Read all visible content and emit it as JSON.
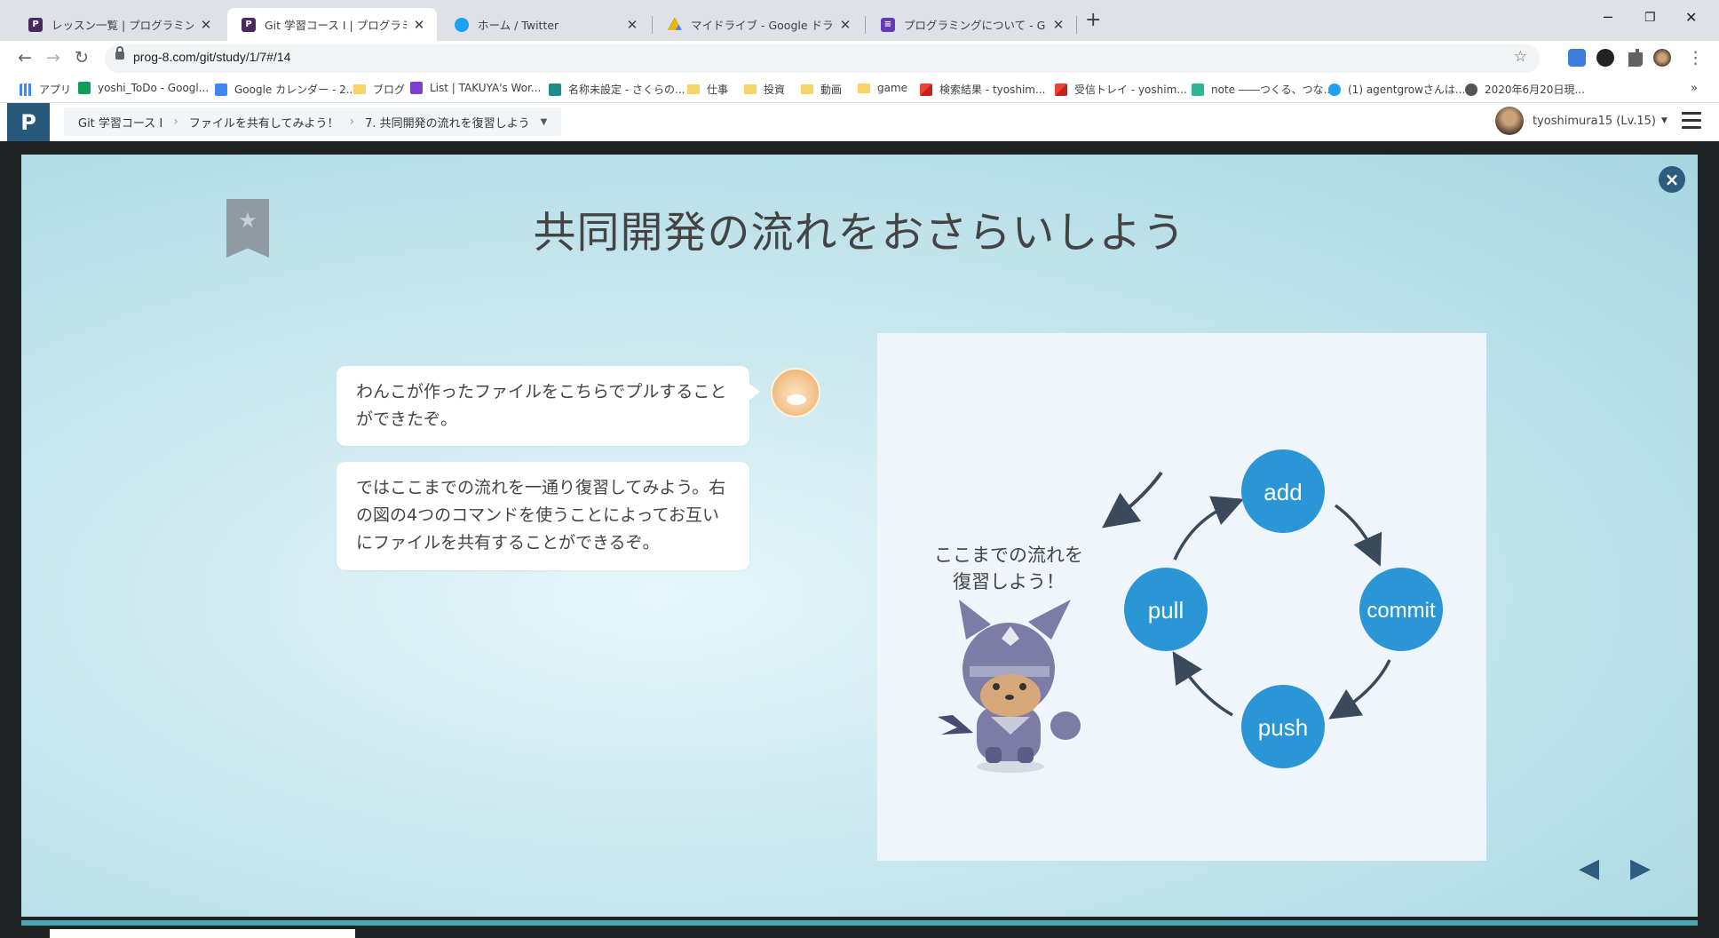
{
  "browser": {
    "tabs": [
      {
        "title": "レッスン一覧 | プログラミングの入門な",
        "active": false
      },
      {
        "title": "Git 学習コース I | プログラミングの入門",
        "active": true
      },
      {
        "title": "ホーム / Twitter",
        "active": false
      },
      {
        "title": "マイドライブ - Google ドライブ",
        "active": false
      },
      {
        "title": "プログラミングについて - Google フォー",
        "active": false
      }
    ],
    "new_tab": "+",
    "url": "prog-8.com/git/study/1/7#/14",
    "bookmarks": [
      "アプリ",
      "yoshi_ToDo - Googl...",
      "Google カレンダー - 2...",
      "ブログ",
      "List | TAKUYA's Wor...",
      "名称未設定 - さくらの...",
      "仕事",
      "投資",
      "動画",
      "game",
      "検索結果 - tyoshim...",
      "受信トレイ - yoshim...",
      "note ――つくる、つな...",
      "(1) agentgrowさんは...",
      "2020年6月20日現..."
    ],
    "bookmarks_more": "»",
    "colors": {
      "tabstrip": "#dee1e6",
      "accent": "#1a73e8"
    }
  },
  "site": {
    "breadcrumb": [
      "Git 学習コース I",
      "ファイルを共有してみよう！",
      "7. 共同開発の流れを復習しよう"
    ],
    "user_label": "tyoshimura15 (Lv.15)",
    "brand_color": "#28587a"
  },
  "lesson": {
    "title": "共同開発の流れをおさらいしよう",
    "messages": [
      "わんこが作ったファイルをこちらでプルすることができたぞ。",
      "ではここまでの流れを一通り復習してみよう。右の図の4つのコマンドを使うことによってお互いにファイルを共有することができるぞ。"
    ],
    "diagram": {
      "caption_line1": "ここまでの流れを",
      "caption_line2": "復習しよう！",
      "steps": [
        "add",
        "commit",
        "push",
        "pull"
      ],
      "node_color": "#2a96d6"
    },
    "nav": {
      "prev": "◀",
      "next": "▶"
    },
    "close": "×"
  }
}
